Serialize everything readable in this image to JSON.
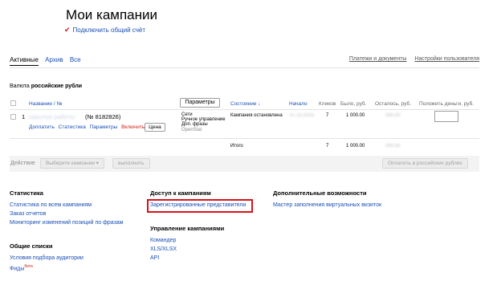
{
  "header": {
    "title": "Мои кампании",
    "connect_account": "Подключить общий счёт"
  },
  "tabs": {
    "active": "Активные",
    "archive": "Архив",
    "all": "Все"
  },
  "top_links": {
    "payments": "Платежи и документы",
    "user_settings": "Настройки пользователя"
  },
  "currency": {
    "label": "Валюта",
    "value": "российские рубли"
  },
  "table": {
    "params_button": "Параметры",
    "headers": {
      "name": "Название / №",
      "state": "Состояние ↓",
      "start": "Начало",
      "clicks": "Кликов",
      "spent": "Было, руб.",
      "left": "Осталось, руб.",
      "deposit": "Положить деньги, руб."
    },
    "campaign": {
      "index": "1",
      "name_hidden": "скрытые работы",
      "number": "(№ 8182826)",
      "links": {
        "pay": "Доплатить",
        "stats": "Статистика",
        "params": "Параметры",
        "enable": "Включить"
      },
      "price_button": "Цена",
      "strategy": [
        "Сети",
        "Ручное управление",
        "Доп. фразы",
        "OpenStat"
      ],
      "status": "Кампания остановлена",
      "start_date": "07.12.2015",
      "clicks": "7",
      "spent": "1 000.00",
      "left": "000.00"
    },
    "total": {
      "label": "Итого",
      "clicks": "7",
      "spent": "1 000.00",
      "left": "000.00"
    }
  },
  "actions": {
    "label": "Действие",
    "select_campaigns": "Выберите кампании",
    "execute": "выполнить",
    "pay_rub": "Оплатить в российских рублях"
  },
  "footer": {
    "statistics": {
      "title": "Статистика",
      "links": [
        "Статистика по всем кампаниям",
        "Заказ отчетов",
        "Мониторинг изменений позиций по фразам"
      ]
    },
    "common_lists": {
      "title": "Общие списки",
      "links": [
        "Условия подбора аудитории",
        "Фиды"
      ],
      "beta": "бета"
    },
    "access": {
      "title": "Доступ к кампаниям",
      "link": "Зарегистрированные представители"
    },
    "management": {
      "title": "Управление кампаниями",
      "links": [
        "Командер",
        "XLS/XLSX",
        "API"
      ]
    },
    "extra": {
      "title": "Дополнительные возможности",
      "link": "Мастер заполнения виртуальных визиток"
    }
  }
}
